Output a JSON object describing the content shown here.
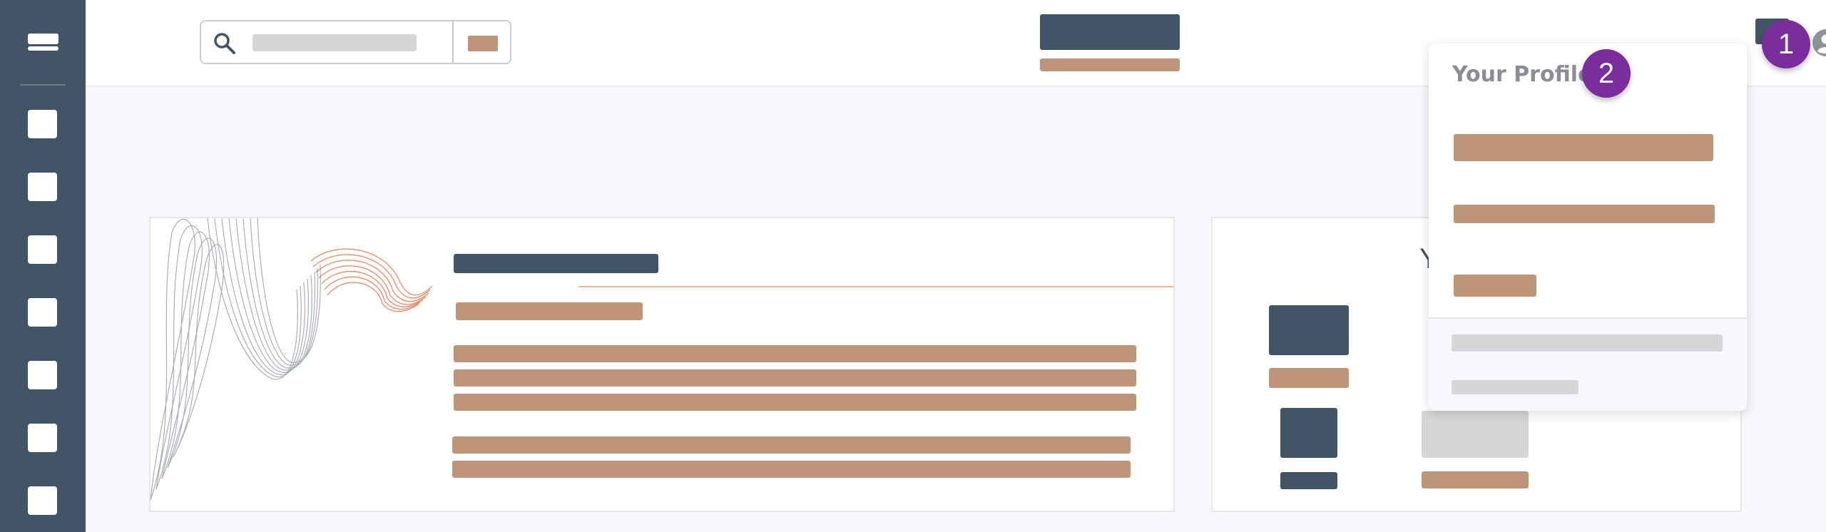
{
  "dropdown": {
    "title": "Your Profile"
  },
  "badges": {
    "first": "1",
    "second": "2"
  },
  "card2": {
    "heading_glyph": "Y"
  },
  "colors": {
    "sidebar": "#425566",
    "placeholder_block": "#bf9578",
    "gray_block": "#d6d6d8",
    "badge": "#7b2d9e",
    "wave_accent": "#ea6b3c"
  },
  "icons": {
    "menu": "menu-icon",
    "search": "search-icon",
    "user": "user-icon"
  }
}
